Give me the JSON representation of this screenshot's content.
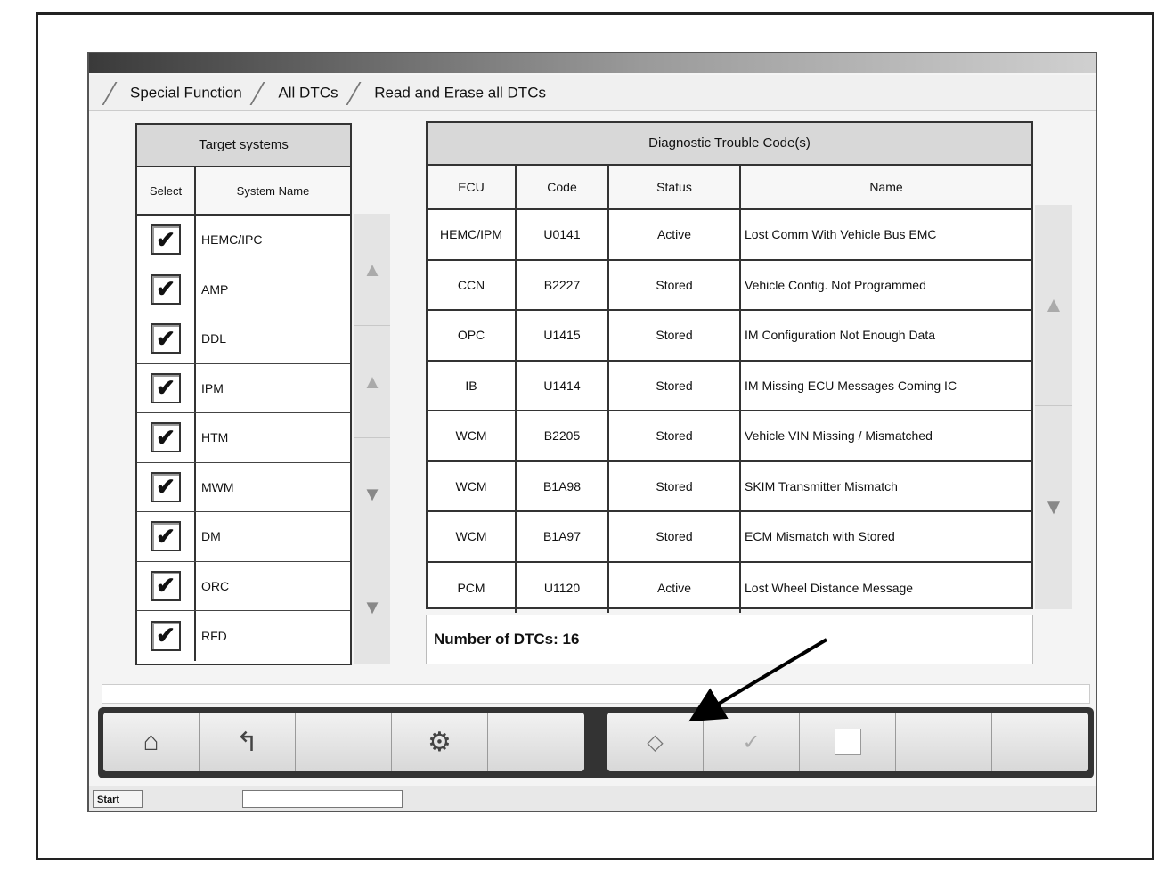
{
  "window": {
    "title": ""
  },
  "breadcrumb": {
    "items": [
      "Special Function",
      "All DTCs",
      "Read and Erase all DTCs"
    ]
  },
  "target_systems": {
    "title": "Target systems",
    "col_select": "Select",
    "col_name": "System Name",
    "rows": [
      {
        "checked": true,
        "name": "HEMC/IPC"
      },
      {
        "checked": true,
        "name": "AMP"
      },
      {
        "checked": true,
        "name": "DDL"
      },
      {
        "checked": true,
        "name": "IPM"
      },
      {
        "checked": true,
        "name": "HTM"
      },
      {
        "checked": true,
        "name": "MWM"
      },
      {
        "checked": true,
        "name": "DM"
      },
      {
        "checked": true,
        "name": "ORC"
      },
      {
        "checked": true,
        "name": "RFD"
      }
    ]
  },
  "dtc_table": {
    "title": "Diagnostic Trouble Code(s)",
    "columns": [
      "ECU",
      "Code",
      "Status",
      "Name"
    ],
    "rows": [
      {
        "ecu": "HEMC/IPM",
        "code": "U0141",
        "status": "Active",
        "name": "Lost Comm With Vehicle Bus EMC"
      },
      {
        "ecu": "CCN",
        "code": "B2227",
        "status": "Stored",
        "name": "Vehicle Config. Not Programmed"
      },
      {
        "ecu": "OPC",
        "code": "U1415",
        "status": "Stored",
        "name": "IM Configuration Not Enough Data"
      },
      {
        "ecu": "IB",
        "code": "U1414",
        "status": "Stored",
        "name": "IM Missing ECU Messages Coming IC"
      },
      {
        "ecu": "WCM",
        "code": "B2205",
        "status": "Stored",
        "name": "Vehicle VIN Missing / Mismatched"
      },
      {
        "ecu": "WCM",
        "code": "B1A98",
        "status": "Stored",
        "name": "SKIM Transmitter Mismatch"
      },
      {
        "ecu": "WCM",
        "code": "B1A97",
        "status": "Stored",
        "name": "ECM Mismatch with Stored"
      },
      {
        "ecu": "PCM",
        "code": "U1120",
        "status": "Active",
        "name": "Lost Wheel Distance Message"
      }
    ]
  },
  "summary": {
    "count_text": "Number of DTCs: 16"
  },
  "status_bar": {
    "text": ""
  },
  "toolbar": {
    "icons": [
      "home-icon",
      "back-icon",
      "blank",
      "settings-icon",
      "blank",
      "erase-icon",
      "check-icon",
      "checkbox-empty-icon",
      "blank",
      "blank"
    ]
  },
  "taskbar": {
    "start_label": "Start",
    "task_label": "",
    "tray_text": ""
  },
  "colors": {
    "header_bg": "#d8d8d8",
    "toolbar_dark": "#333333",
    "arrow": "#000000"
  }
}
